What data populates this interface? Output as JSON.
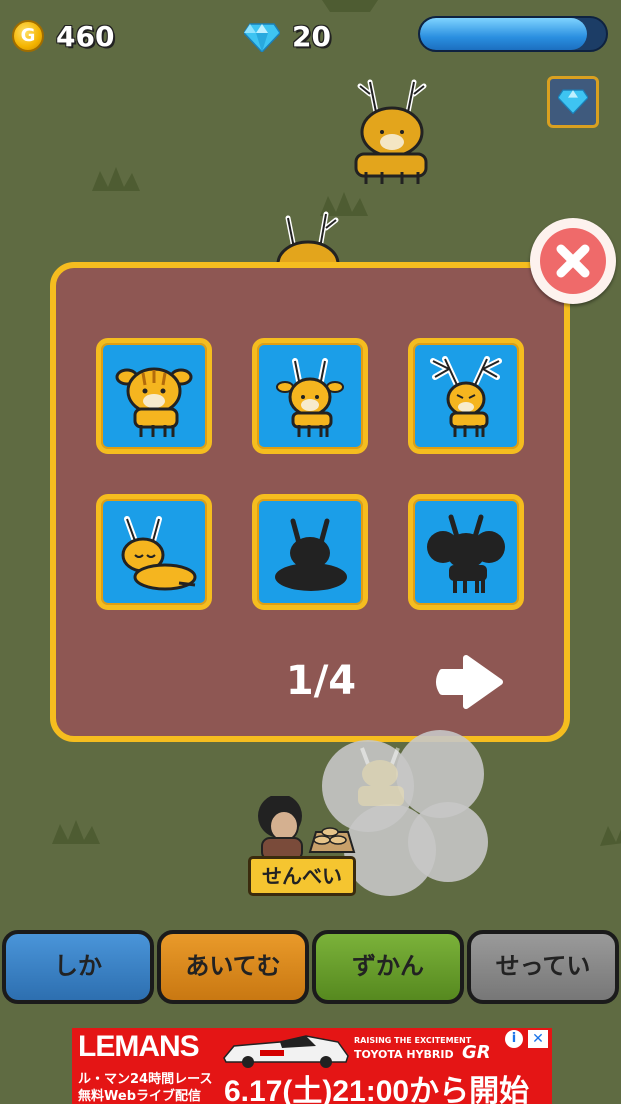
{
  "hud": {
    "coins": "460",
    "coin_icon_letter": "G",
    "gems": "20",
    "energy_fraction": 0.9
  },
  "panel": {
    "page": "1/4"
  },
  "vendor": {
    "sign": "せんべい"
  },
  "tabs": [
    {
      "label": "しか"
    },
    {
      "label": "あいてむ"
    },
    {
      "label": "ずかん"
    },
    {
      "label": "せってい"
    }
  ],
  "ad": {
    "title": "LEMANS",
    "tagline_small": "RAISING THE EXCITEMENT",
    "tagline_brand": "TOYOTA HYBRID",
    "gr_logo": "GR",
    "sub_line1": "ル・マン24時間レース",
    "sub_line2": "無料Webライブ配信",
    "date": "6.17(土)21:00から開始",
    "info_glyph": "i",
    "close_glyph": "✕"
  },
  "colors": {
    "background": "#5f6b42",
    "panel": "#8e5753",
    "panel_border": "#f5bd1f",
    "card": "#1b9ee8",
    "close_button": "#ef6a6a"
  },
  "icons": {
    "coin": "coin-icon",
    "gem": "diamond-icon",
    "close": "close-icon",
    "next": "right-arrow-icon"
  }
}
